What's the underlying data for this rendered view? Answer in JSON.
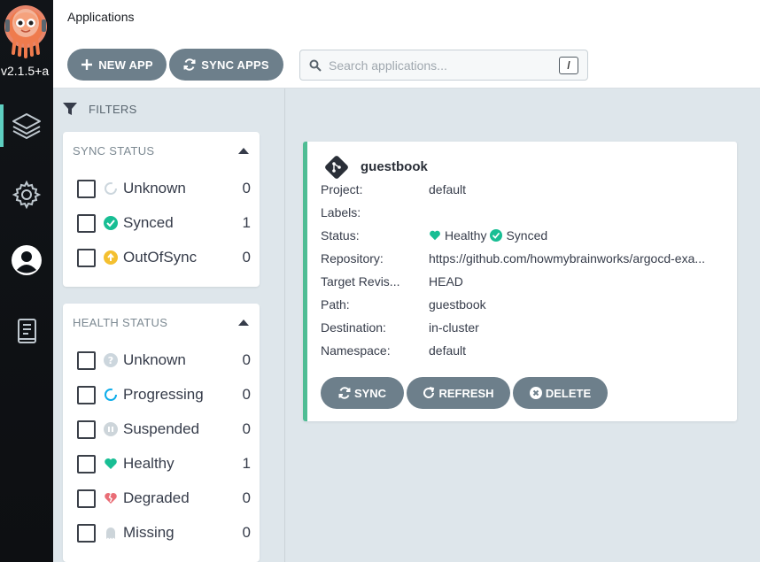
{
  "nav": {
    "version": "v2.1.5+a",
    "items": [
      {
        "icon": "layers-icon"
      },
      {
        "icon": "gear-icon"
      },
      {
        "icon": "user-icon"
      },
      {
        "icon": "docs-icon"
      }
    ]
  },
  "header": {
    "title": "Applications"
  },
  "toolbar": {
    "new_app_label": "NEW APP",
    "sync_apps_label": "SYNC APPS",
    "search_placeholder": "Search applications...",
    "search_shortcut": "/"
  },
  "filters": {
    "heading": "FILTERS",
    "sync_status": {
      "title": "SYNC STATUS",
      "items": [
        {
          "label": "Unknown",
          "count": "0",
          "icon": "circle-notch-icon",
          "color": "#ccd6dd"
        },
        {
          "label": "Synced",
          "count": "1",
          "icon": "check-circle-icon",
          "color": "#18be94"
        },
        {
          "label": "OutOfSync",
          "count": "0",
          "icon": "arrow-up-circle-icon",
          "color": "#f4c030"
        }
      ]
    },
    "health_status": {
      "title": "HEALTH STATUS",
      "items": [
        {
          "label": "Unknown",
          "count": "0",
          "icon": "question-circle-icon",
          "color": "#ccd6dd"
        },
        {
          "label": "Progressing",
          "count": "0",
          "icon": "circle-notch-icon",
          "color": "#0dadea"
        },
        {
          "label": "Suspended",
          "count": "0",
          "icon": "pause-circle-icon",
          "color": "#cdd5da"
        },
        {
          "label": "Healthy",
          "count": "1",
          "icon": "heart-icon",
          "color": "#18be94"
        },
        {
          "label": "Degraded",
          "count": "0",
          "icon": "broken-heart-icon",
          "color": "#e96d76"
        },
        {
          "label": "Missing",
          "count": "0",
          "icon": "ghost-icon",
          "color": "#cdd5da"
        }
      ]
    }
  },
  "app": {
    "name": "guestbook",
    "fields": [
      {
        "key": "Project:",
        "value": "default"
      },
      {
        "key": "Labels:",
        "value": ""
      },
      {
        "key": "Status:",
        "value": ""
      },
      {
        "key": "Repository:",
        "value": "https://github.com/howmybrainworks/argocd-exa..."
      },
      {
        "key": "Target Revis...",
        "value": "HEAD"
      },
      {
        "key": "Path:",
        "value": "guestbook"
      },
      {
        "key": "Destination:",
        "value": "in-cluster"
      },
      {
        "key": "Namespace:",
        "value": "default"
      }
    ],
    "health": "Healthy",
    "sync": "Synced",
    "health_color": "#18be94",
    "sync_color": "#18be94",
    "actions": {
      "sync": "SYNC",
      "refresh": "REFRESH",
      "delete": "DELETE"
    },
    "accent_color": "#4fbd94"
  }
}
